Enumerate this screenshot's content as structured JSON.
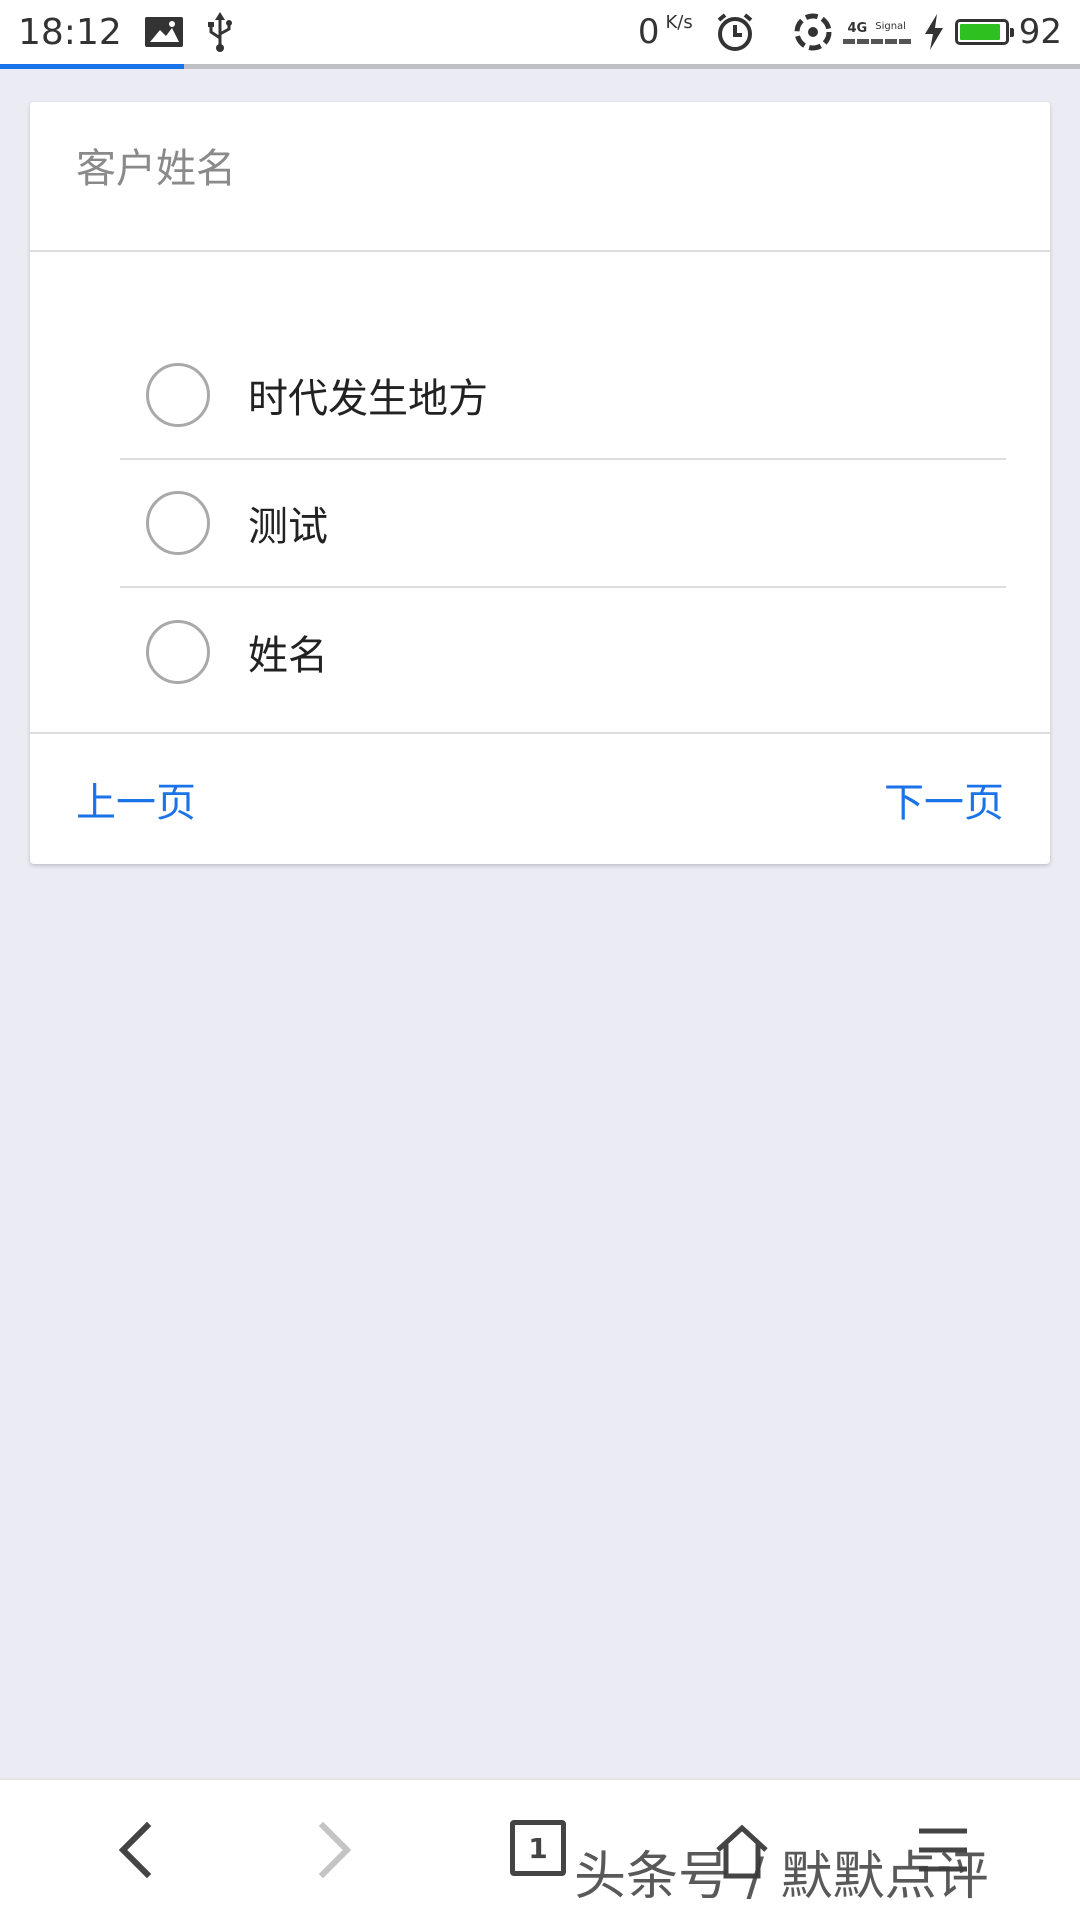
{
  "status_bar": {
    "time": "18:12",
    "net_speed": "0",
    "net_speed_unit": "K/s",
    "network_type": "4G",
    "signal_label": "Signal",
    "battery_percent": "92",
    "battery_level": 0.92,
    "icons": [
      "image-icon",
      "usb-icon",
      "alarm-icon",
      "hotspot-icon",
      "signal-icon",
      "charging-icon",
      "battery-icon"
    ]
  },
  "page_progress": 0.17,
  "form": {
    "question_title": "客户姓名",
    "options": [
      {
        "label": "时代发生地方",
        "selected": false
      },
      {
        "label": "测试",
        "selected": false
      },
      {
        "label": "姓名",
        "selected": false
      }
    ],
    "prev_label": "上一页",
    "next_label": "下一页"
  },
  "bottom_nav": {
    "tab_count": "1",
    "icons": [
      "back-icon",
      "forward-icon",
      "tabs-icon",
      "home-icon",
      "menu-icon"
    ]
  },
  "watermark": "头条号 / 默默点评",
  "colors": {
    "accent": "#1a73e8",
    "background": "#ebebf3",
    "battery": "#2dc01f"
  }
}
